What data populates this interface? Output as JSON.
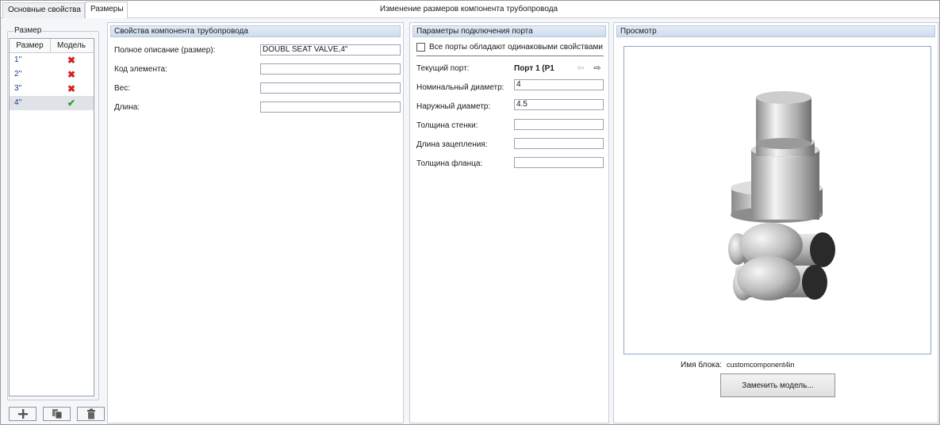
{
  "tabs": [
    {
      "label": "Основные свойства"
    },
    {
      "label": "Размеры"
    }
  ],
  "window_title": "Изменение размеров компонента трубопровода",
  "size_group": {
    "legend": "Размер",
    "columns": {
      "size": "Размер",
      "model": "Модель"
    },
    "rows": [
      {
        "size": "1''",
        "model_icon": "x-icon",
        "model_mark": "✖"
      },
      {
        "size": "2''",
        "model_icon": "x-icon",
        "model_mark": "✖"
      },
      {
        "size": "3''",
        "model_icon": "x-icon",
        "model_mark": "✖"
      },
      {
        "size": "4''",
        "model_icon": "check-icon",
        "model_mark": "✔"
      }
    ],
    "selected_index": 3
  },
  "component_props": {
    "header": "Свойства компонента трубопровода",
    "fields": [
      {
        "label": "Полное описание (размер):",
        "value": "DOUBL SEAT VALVE,4\""
      },
      {
        "label": "Код элемента:",
        "value": ""
      },
      {
        "label": "Вес:",
        "value": ""
      },
      {
        "label": "Длина:",
        "value": ""
      }
    ]
  },
  "port_params": {
    "header": "Параметры подключения порта",
    "all_ports_same_label": "Все порты обладают одинаковыми свойствами",
    "all_ports_same_checked": false,
    "current_port_label": "Текущий порт:",
    "current_port_value": "Порт 1 (P1",
    "fields": [
      {
        "label": "Номинальный диаметр:",
        "value": "4"
      },
      {
        "label": "Наружный диаметр:",
        "value": "4.5"
      },
      {
        "label": "Толщина стенки:",
        "value": ""
      },
      {
        "label": "Длина зацепления:",
        "value": ""
      },
      {
        "label": "Толщина фланца:",
        "value": ""
      }
    ]
  },
  "preview": {
    "header": "Просмотр",
    "block_name_label": "Имя блока:",
    "block_name_value": "customcomponent4in",
    "replace_button": "Заменить модель..."
  },
  "colors": {
    "accent_header": "#cfdcee",
    "error": "#d42121",
    "success": "#2aa02a"
  }
}
